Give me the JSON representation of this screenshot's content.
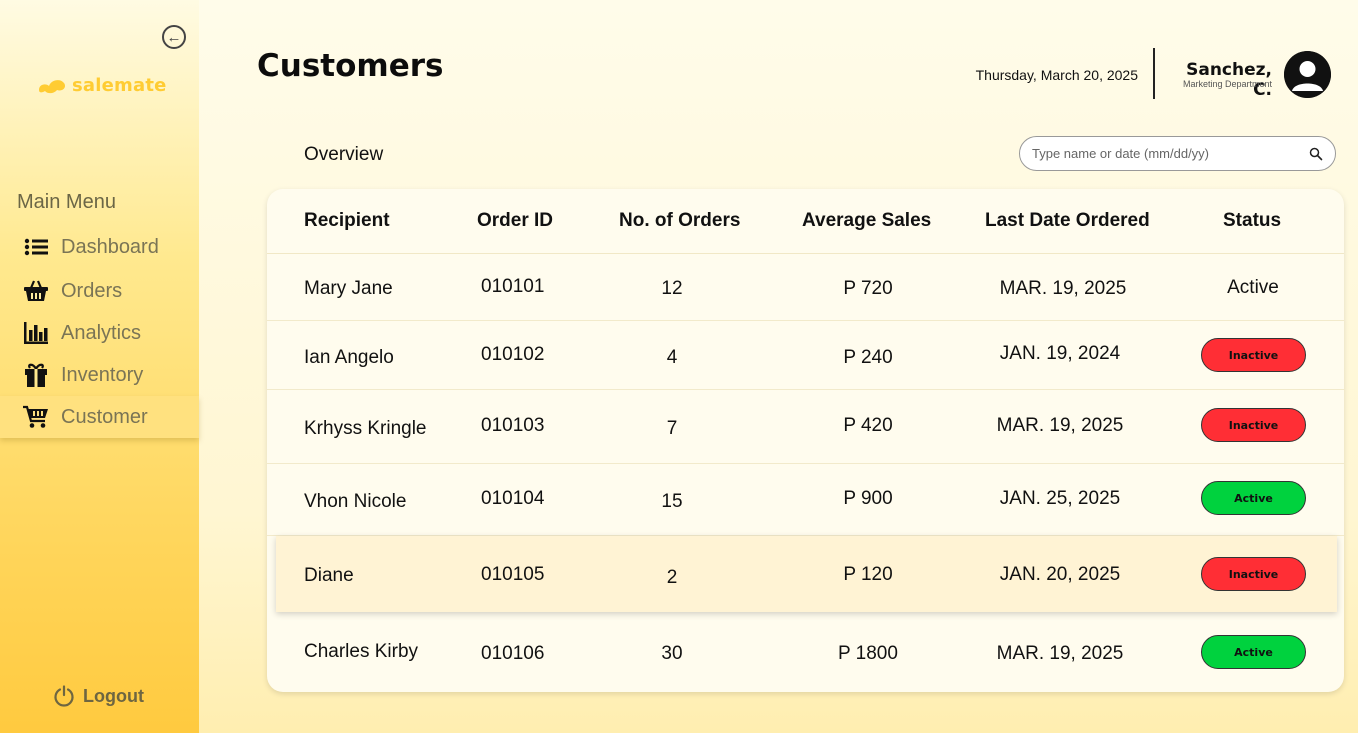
{
  "app": {
    "brand": "salemate",
    "brand_color": "#ffcc33"
  },
  "sidebar": {
    "collapse_icon": "arrow-left-circle-icon",
    "menu_title": "Main Menu",
    "items": [
      {
        "label": "Dashboard",
        "icon": "list-icon",
        "active": false
      },
      {
        "label": "Orders",
        "icon": "basket-icon",
        "active": false
      },
      {
        "label": "Analytics",
        "icon": "bar-chart-icon",
        "active": false
      },
      {
        "label": "Inventory",
        "icon": "gift-box-icon",
        "active": false
      },
      {
        "label": "Customer",
        "icon": "cart-icon",
        "active": true
      }
    ],
    "logout_label": "Logout"
  },
  "header": {
    "title": "Customers",
    "date": "Thursday, March 20, 2025",
    "user_name": "Sanchez, C.",
    "user_department": "Marketing Department"
  },
  "overview": {
    "label": "Overview",
    "search_placeholder": "Type name or date (mm/dd/yy)"
  },
  "table": {
    "columns": [
      "Recipient",
      "Order ID",
      "No. of Orders",
      "Average Sales",
      "Last Date Ordered",
      "Status"
    ],
    "rows": [
      {
        "recipient": "Mary Jane",
        "order_id": "010101",
        "orders": "12",
        "avg_sales": "P 720",
        "last_date": "MAR. 19, 2025",
        "status": "Active",
        "status_style": "text"
      },
      {
        "recipient": "Ian Angelo",
        "order_id": "010102",
        "orders": "4",
        "avg_sales": "P 240",
        "last_date": "JAN. 19, 2024",
        "status": "Inactive",
        "status_style": "pill"
      },
      {
        "recipient": "Krhyss Kringle",
        "order_id": "010103",
        "orders": "7",
        "avg_sales": "P 420",
        "last_date": "MAR. 19, 2025",
        "status": "Inactive",
        "status_style": "pill"
      },
      {
        "recipient": "Vhon Nicole",
        "order_id": "010104",
        "orders": "15",
        "avg_sales": "P 900",
        "last_date": "JAN. 25, 2025",
        "status": "Active",
        "status_style": "pill"
      },
      {
        "recipient": "Diane",
        "order_id": "010105",
        "orders": "2",
        "avg_sales": "P 120",
        "last_date": "JAN. 20, 2025",
        "status": "Inactive",
        "status_style": "pill"
      },
      {
        "recipient": "Charles Kirby",
        "order_id": "010106",
        "orders": "30",
        "avg_sales": "P 1800",
        "last_date": "MAR. 19, 2025",
        "status": "Active",
        "status_style": "pill"
      }
    ],
    "status_colors": {
      "Active": "#00d23e",
      "Inactive": "#ff2e35"
    }
  }
}
